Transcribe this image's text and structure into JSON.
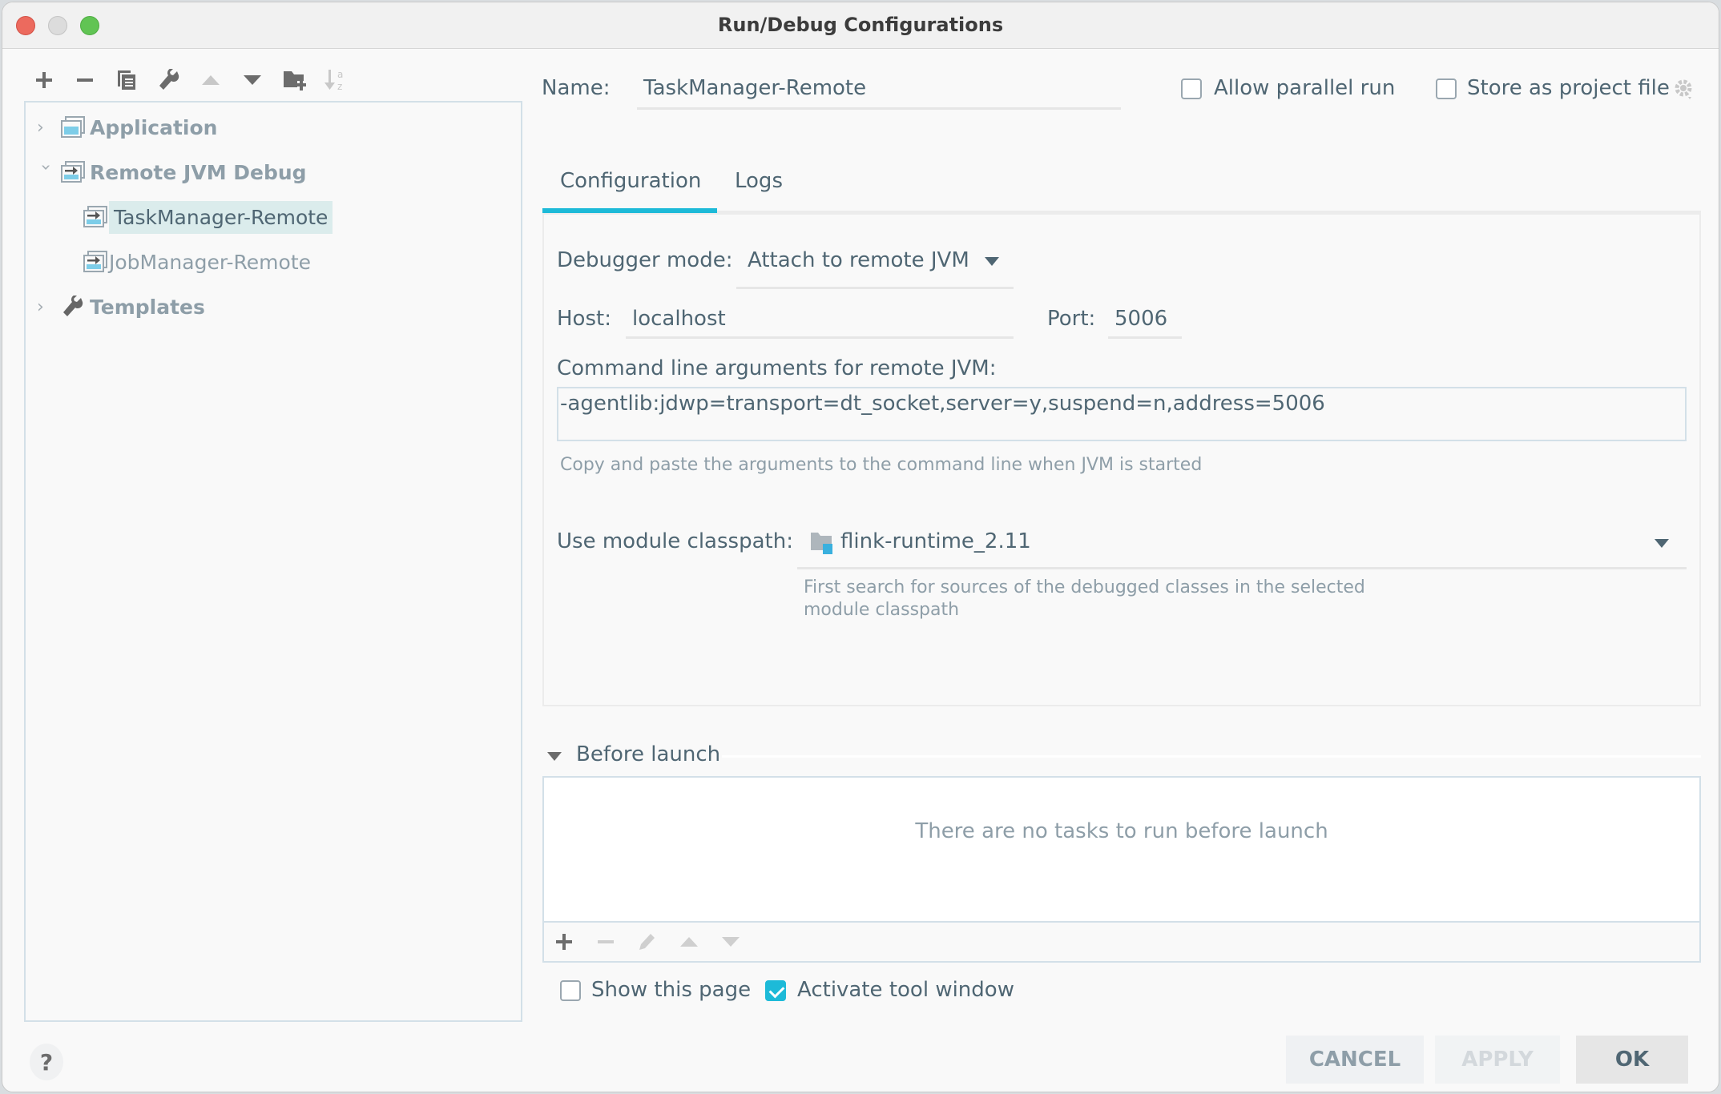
{
  "window": {
    "title": "Run/Debug Configurations"
  },
  "toolbar": {
    "icons": [
      "add-icon",
      "remove-icon",
      "copy-icon",
      "wrench-icon",
      "move-up-icon",
      "move-down-icon",
      "new-folder-icon",
      "sort-alpha-icon"
    ]
  },
  "tree": {
    "items": [
      {
        "label": "Application",
        "type": "group",
        "expanded": false
      },
      {
        "label": "Remote JVM Debug",
        "type": "group",
        "expanded": true
      },
      {
        "label": "TaskManager-Remote",
        "type": "config",
        "selected": true
      },
      {
        "label": "JobManager-Remote",
        "type": "config",
        "selected": false
      },
      {
        "label": "Templates",
        "type": "group",
        "expanded": false
      }
    ]
  },
  "header": {
    "name_label": "Name:",
    "name_value": "TaskManager-Remote",
    "allow_parallel_label": "Allow parallel run",
    "allow_parallel_checked": false,
    "store_project_label": "Store as project file",
    "store_project_checked": false
  },
  "tabs": [
    {
      "label": "Configuration",
      "active": true
    },
    {
      "label": "Logs",
      "active": false
    }
  ],
  "config": {
    "debugger_mode_label": "Debugger mode:",
    "debugger_mode_value": "Attach to remote JVM",
    "host_label": "Host:",
    "host_value": "localhost",
    "port_label": "Port:",
    "port_value": "5006",
    "cmdline_label": "Command line arguments for remote JVM:",
    "cmdline_value": "-agentlib:jdwp=transport=dt_socket,server=y,suspend=n,address=5006",
    "cmdline_hint": "Copy and paste the arguments to the command line when JVM is started",
    "classpath_label": "Use module classpath:",
    "classpath_value": "flink-runtime_2.11",
    "classpath_hint_line1": "First search for sources of the debugged classes in the selected",
    "classpath_hint_line2": "module classpath"
  },
  "before_launch": {
    "title": "Before launch",
    "empty_text": "There are no tasks to run before launch",
    "show_page_label": "Show this page",
    "show_page_checked": false,
    "activate_tool_label": "Activate tool window",
    "activate_tool_checked": true
  },
  "buttons": {
    "cancel": "CANCEL",
    "apply": "APPLY",
    "ok": "OK",
    "help": "?"
  },
  "colors": {
    "accent": "#1dbad8",
    "selection": "#dbecec",
    "text": "#4f6673",
    "muted": "#8e9ea8"
  }
}
